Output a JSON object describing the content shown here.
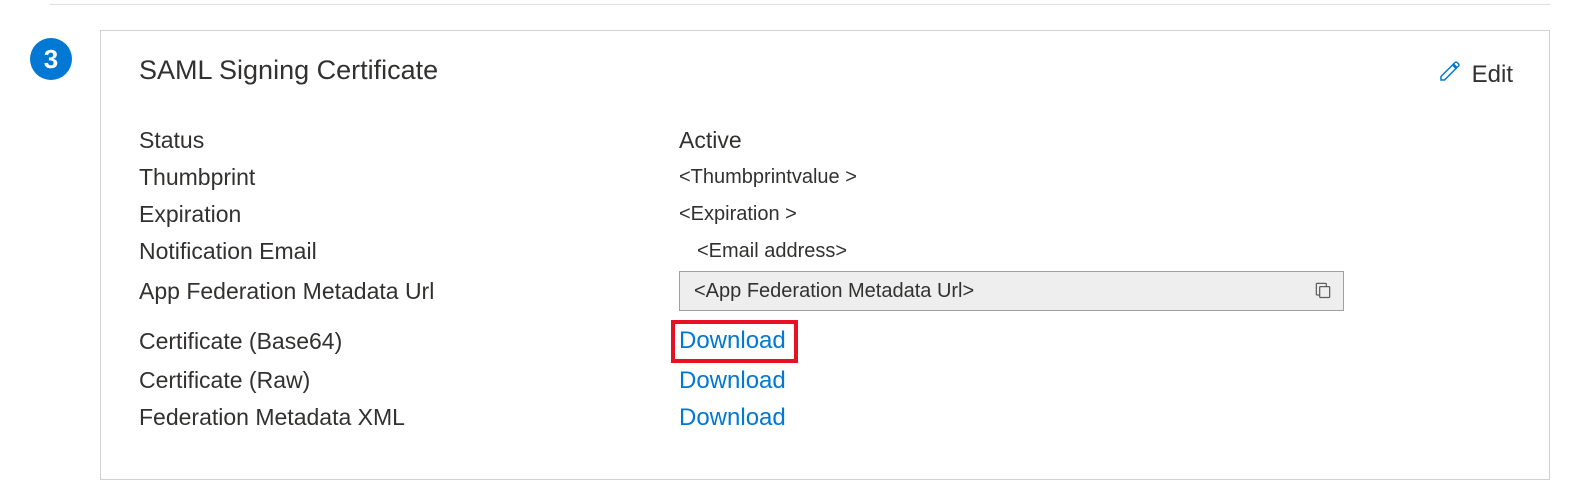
{
  "step": {
    "number": "3"
  },
  "card": {
    "title": "SAML Signing Certificate",
    "edit_label": "Edit"
  },
  "fields": {
    "status": {
      "label": "Status",
      "value": "Active"
    },
    "thumbprint": {
      "label": "Thumbprint",
      "value": "<Thumbprintvalue >"
    },
    "expiration": {
      "label": "Expiration",
      "value": "<Expiration >"
    },
    "notification_email": {
      "label": "Notification Email",
      "value": "<Email address>"
    },
    "metadata_url": {
      "label": "App Federation Metadata Url",
      "value": "<App Federation Metadata Url>"
    },
    "cert_base64": {
      "label": "Certificate (Base64)",
      "link": "Download"
    },
    "cert_raw": {
      "label": "Certificate (Raw)",
      "link": "Download"
    },
    "fed_xml": {
      "label": "Federation Metadata XML",
      "link": "Download"
    }
  }
}
